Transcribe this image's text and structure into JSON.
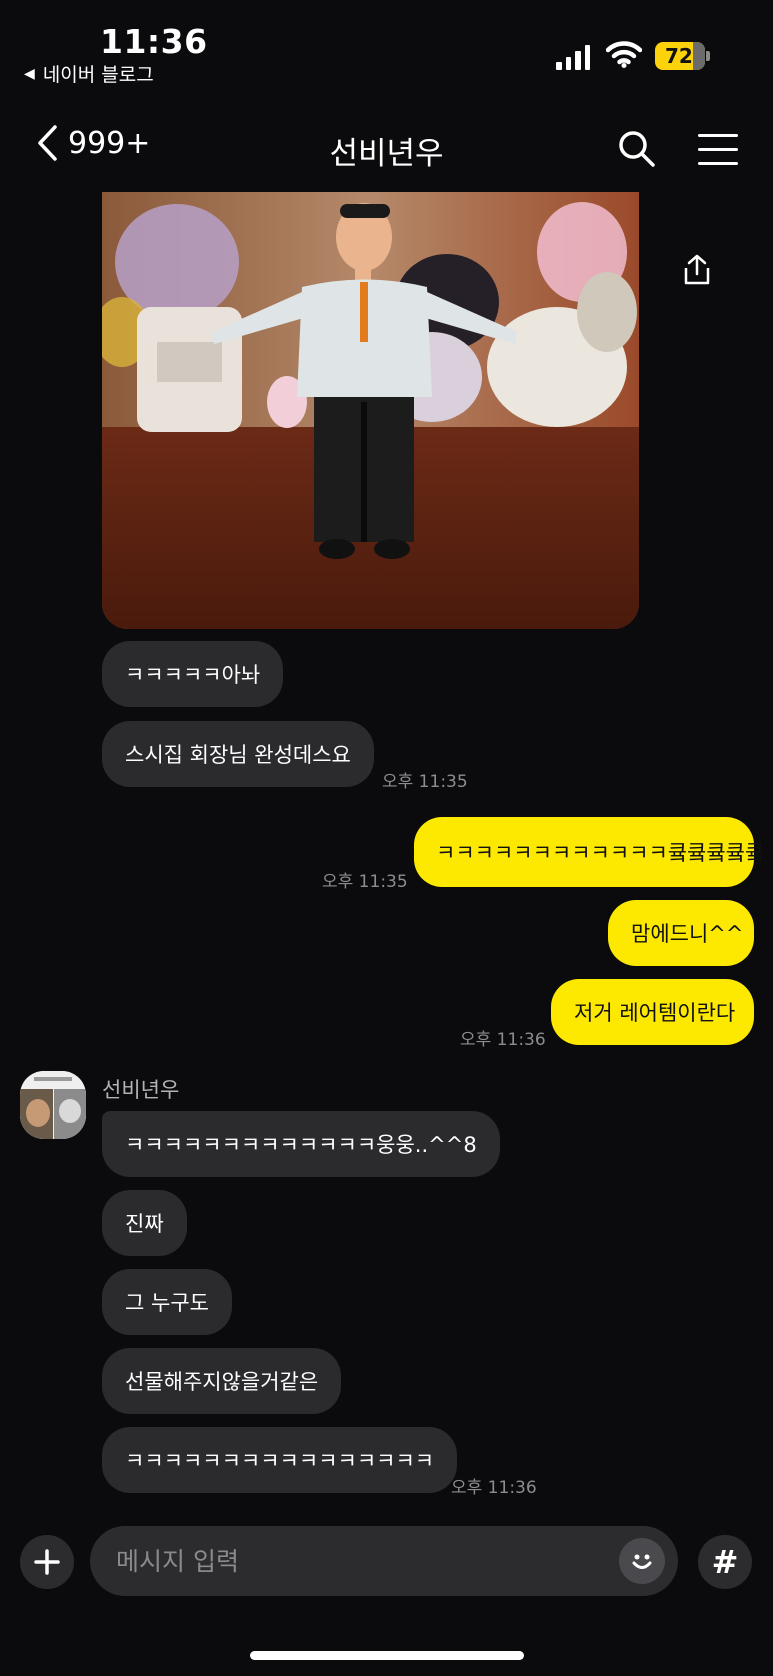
{
  "status": {
    "time": "11:36",
    "back_app": "네이버 블로그",
    "battery": "72"
  },
  "header": {
    "back_count": "999+",
    "title": "선비년우"
  },
  "messages": {
    "m1": "ㅋㅋㅋㅋㅋ아놔",
    "m2": "스시집 회장님 완성데스요",
    "t1": "오후 11:35",
    "o1": "ㅋㅋㅋㅋㅋㅋㅋㅋㅋㅋㅋㅋ큨큨큨큨큨",
    "t2": "오후 11:35",
    "o2": "맘에드니^^",
    "o3": "저거 레어템이란다",
    "t3": "오후 11:36",
    "sender": "선비년우",
    "r1": "ㅋㅋㅋㅋㅋㅋㅋㅋㅋㅋㅋㅋㅋ웅웅..^^8",
    "r2": "진짜",
    "r3": "그 누구도",
    "r4": "선물해주지않을거같은",
    "r5": "ㅋㅋㅋㅋㅋㅋㅋㅋㅋㅋㅋㅋㅋㅋㅋㅋ",
    "t4": "오후 11:36"
  },
  "input": {
    "placeholder": "메시지 입력"
  },
  "colors": {
    "background": "#0b0b0d",
    "incoming_bubble": "#2b2b2e",
    "outgoing_bubble": "#fde800",
    "battery": "#fcd30a"
  }
}
